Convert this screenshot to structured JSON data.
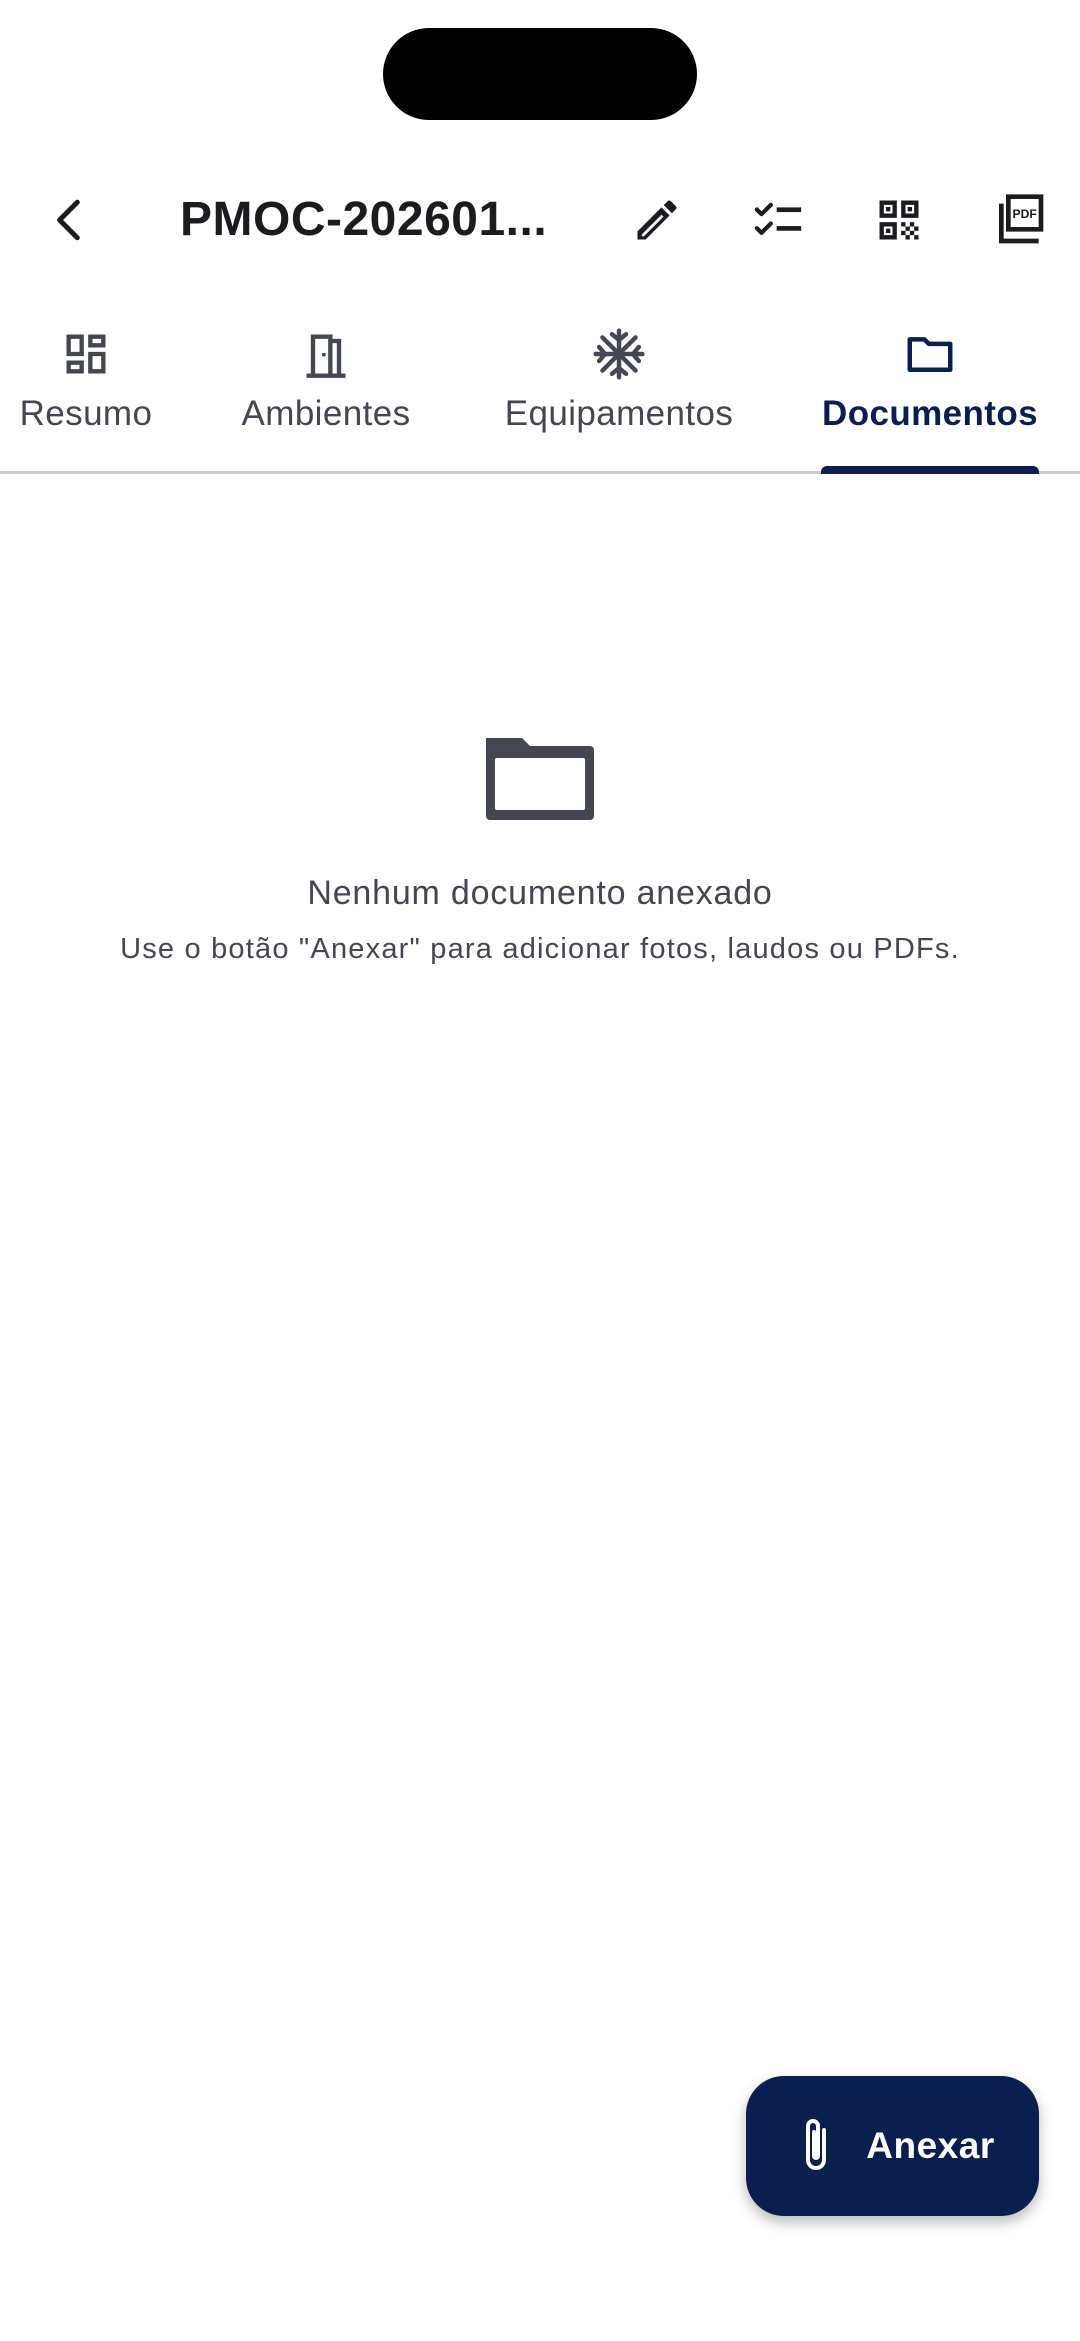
{
  "app_bar": {
    "title": "PMOC-202601...",
    "icons": [
      "arrow-back-icon",
      "edit-pencil-icon",
      "checklist-icon",
      "qr-code-icon",
      "pdf-icon"
    ]
  },
  "tabs": [
    {
      "label": "Resumo",
      "icon": "dashboard-icon",
      "active": false
    },
    {
      "label": "Ambientes",
      "icon": "door-icon",
      "active": false
    },
    {
      "label": "Equipamentos",
      "icon": "snowflake-icon",
      "active": false
    },
    {
      "label": "Documentos",
      "icon": "folder-icon",
      "active": true
    }
  ],
  "empty_state": {
    "icon": "folder-icon",
    "title": "Nenhum documento anexado",
    "subtitle": "Use o botão \"Anexar\" para adicionar fotos, laudos ou PDFs."
  },
  "fab": {
    "label": "Anexar",
    "icon": "paperclip-icon"
  },
  "colors": {
    "primary": "#0b1f4f",
    "text": "#1b1c20",
    "muted_text": "#44474f",
    "divider": "#c9cad3",
    "background": "#ffffff"
  }
}
